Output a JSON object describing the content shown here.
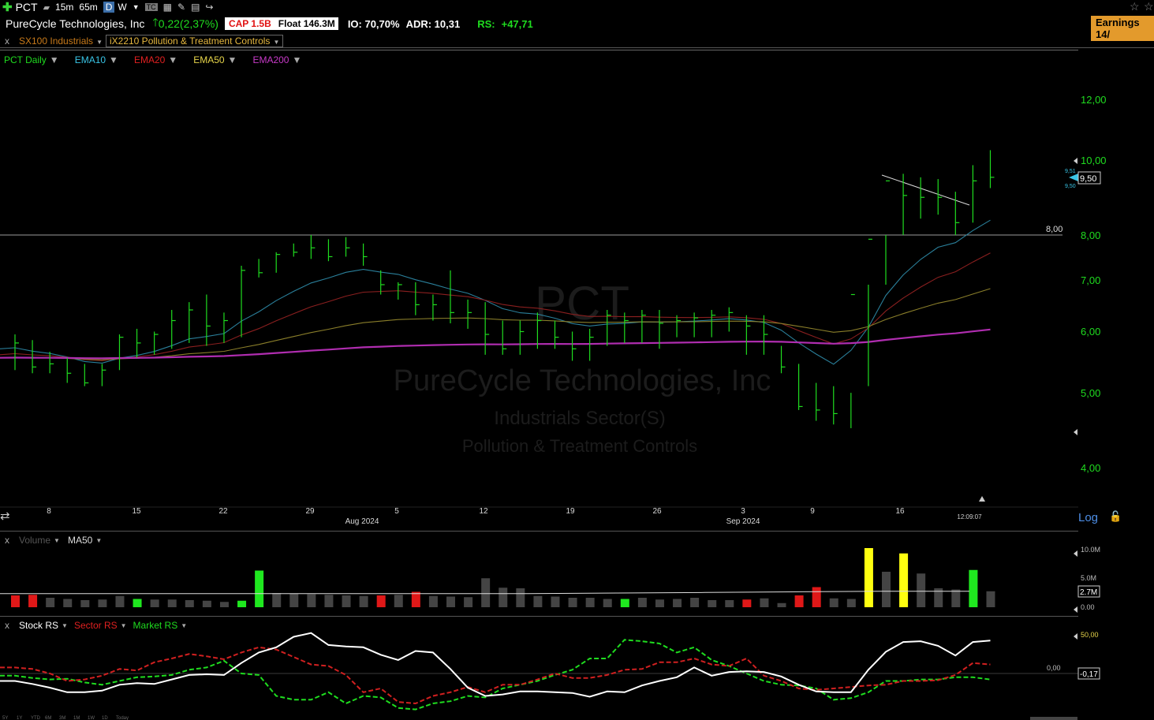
{
  "toolbar": {
    "symbol": "PCT",
    "timeframes": [
      "15m",
      "65m",
      "D",
      "W"
    ],
    "earnings": "Earnings 14/"
  },
  "header": {
    "company": "PureCycle Technologies, Inc",
    "change": "0,22(2,37%)",
    "cap_label": "CAP 1.5B",
    "float_label": "Float 146.3M",
    "io": "IO: 70,70%",
    "adr": "ADR: 10,31",
    "rs_label": "RS:",
    "rs_value": "+47,71"
  },
  "groups": {
    "close": "x",
    "index": "SX100 Industrials",
    "industry": "iX2210 Pollution & Treatment Controls"
  },
  "price_legend": [
    {
      "label": "PCT Daily",
      "color": "#1fdc1f"
    },
    {
      "label": "EMA10",
      "color": "#39c5e6"
    },
    {
      "label": "EMA20",
      "color": "#e02020"
    },
    {
      "label": "EMA50",
      "color": "#e6d44a"
    },
    {
      "label": "EMA200",
      "color": "#c83ac8"
    }
  ],
  "watermark": {
    "symbol": "PCT",
    "name": "PureCycle Technologies, Inc",
    "sector": "Industrials Sector(S)",
    "industry": "Pollution & Treatment Controls"
  },
  "price_axis": {
    "ticks": [
      "12,00",
      "10,00",
      "8,00",
      "7,00",
      "6,00",
      "5,00",
      "4,00"
    ],
    "last_price": "9,50",
    "bid": "9,51",
    "ask": "9,50",
    "hline_label": "8,00",
    "log_label": "Log"
  },
  "date_axis": {
    "days": [
      "8",
      "15",
      "22",
      "29",
      "5",
      "12",
      "19",
      "26",
      "3",
      "9",
      "16"
    ],
    "months": [
      "Aug 2024",
      "Sep 2024"
    ],
    "time": "12:09:07"
  },
  "volume_legend": {
    "close": "x",
    "volume": "Volume",
    "ma": "MA50"
  },
  "volume_axis": {
    "ticks": [
      "10.0M",
      "5.0M",
      "0.00"
    ],
    "ma_value": "2.7M"
  },
  "rs_legend": [
    {
      "label": "Stock RS",
      "color": "#ffffff"
    },
    {
      "label": "Sector RS",
      "color": "#e02020"
    },
    {
      "label": "Market RS",
      "color": "#1fdc1f"
    }
  ],
  "rs_axis": {
    "ticks": [
      "50,00",
      "0,00"
    ],
    "value": "-0,17"
  },
  "ranges": [
    "5Y",
    "1Y",
    "YTD",
    "6M",
    "3M",
    "1M",
    "1W",
    "1D",
    "Today"
  ],
  "chart_data": [
    {
      "type": "ohlc",
      "series": [
        {
          "name": "PCT Daily",
          "dates": [
            "Jul 2",
            "Jul 3",
            "Jul 5",
            "Jul 8",
            "Jul 9",
            "Jul 10",
            "Jul 11",
            "Jul 12",
            "Jul 15",
            "Jul 16",
            "Jul 17",
            "Jul 18",
            "Jul 19",
            "Jul 22",
            "Jul 23",
            "Jul 24",
            "Jul 25",
            "Jul 26",
            "Jul 29",
            "Jul 30",
            "Jul 31",
            "Aug 1",
            "Aug 2",
            "Aug 5",
            "Aug 6",
            "Aug 7",
            "Aug 8",
            "Aug 9",
            "Aug 12",
            "Aug 13",
            "Aug 14",
            "Aug 15",
            "Aug 16",
            "Aug 19",
            "Aug 20",
            "Aug 21",
            "Aug 22",
            "Aug 23",
            "Aug 26",
            "Aug 27",
            "Aug 28",
            "Aug 29",
            "Aug 30",
            "Sep 3",
            "Sep 4",
            "Sep 5",
            "Sep 6",
            "Sep 9",
            "Sep 10",
            "Sep 11",
            "Sep 12",
            "Sep 13",
            "Sep 16",
            "Sep 17",
            "Sep 18",
            "Sep 19",
            "Sep 20"
          ],
          "high": [
            5.95,
            5.85,
            5.65,
            5.55,
            5.45,
            5.45,
            5.95,
            6.05,
            6.0,
            6.4,
            6.55,
            6.7,
            6.35,
            7.3,
            7.45,
            7.6,
            7.8,
            8.0,
            7.9,
            7.95,
            7.8,
            7.2,
            6.95,
            6.95,
            6.7,
            7.2,
            6.6,
            6.55,
            6.2,
            6.2,
            6.35,
            6.2,
            6.0,
            6.05,
            6.4,
            6.35,
            6.4,
            6.4,
            6.3,
            6.35,
            6.4,
            6.45,
            6.3,
            6.3,
            5.75,
            5.45,
            5.15,
            5.1,
            5.0,
            6.9,
            8.0,
            9.6,
            9.5,
            9.45,
            9.1,
            9.85,
            10.3
          ],
          "low": [
            5.35,
            5.3,
            5.3,
            5.15,
            5.1,
            5.1,
            5.35,
            5.55,
            5.6,
            5.7,
            5.8,
            5.75,
            5.8,
            5.9,
            7.05,
            7.15,
            7.5,
            7.45,
            7.4,
            7.5,
            7.3,
            6.7,
            6.6,
            6.3,
            6.2,
            6.15,
            6.05,
            5.6,
            5.6,
            5.6,
            5.7,
            5.7,
            5.5,
            5.5,
            5.75,
            5.8,
            5.8,
            5.7,
            5.9,
            5.9,
            5.9,
            6.0,
            5.6,
            5.6,
            5.3,
            4.75,
            4.6,
            4.55,
            4.5,
            5.1,
            6.9,
            8.0,
            8.4,
            8.5,
            8.0,
            8.3,
            9.2
          ],
          "close": [
            5.8,
            5.4,
            5.45,
            5.3,
            5.15,
            5.35,
            5.9,
            5.8,
            5.95,
            6.2,
            6.4,
            6.1,
            6.2,
            7.2,
            7.15,
            7.55,
            7.6,
            7.7,
            7.5,
            7.7,
            7.5,
            6.9,
            6.9,
            6.5,
            6.5,
            6.35,
            6.35,
            5.95,
            5.7,
            6.0,
            6.2,
            5.9,
            5.7,
            5.9,
            6.3,
            6.2,
            6.3,
            6.15,
            6.2,
            6.25,
            6.3,
            6.35,
            6.1,
            5.95,
            5.4,
            4.8,
            4.75,
            4.7,
            6.7,
            7.9,
            9.4,
            9.0,
            8.95,
            8.95,
            8.3,
            9.4,
            9.5
          ]
        }
      ]
    },
    {
      "type": "bar",
      "title": "Volume",
      "series": [
        {
          "name": "Volume",
          "values": [
            2.0,
            2.1,
            1.6,
            1.4,
            1.2,
            1.3,
            1.9,
            1.4,
            1.3,
            1.3,
            1.2,
            1.1,
            0.9,
            1.1,
            6.2,
            2.4,
            2.3,
            2.2,
            2.1,
            2.0,
            1.9,
            2.0,
            2.1,
            2.6,
            1.9,
            1.8,
            1.7,
            4.9,
            3.3,
            3.2,
            1.9,
            1.8,
            1.6,
            1.6,
            1.4,
            1.4,
            1.6,
            1.3,
            1.4,
            1.6,
            1.2,
            1.2,
            1.3,
            1.5,
            0.7,
            2.0,
            3.4,
            1.5,
            1.4,
            10.0,
            6.0,
            9.1,
            5.7,
            3.2,
            3.0,
            6.3,
            2.7
          ],
          "colors": [
            "red",
            "red",
            "gray",
            "gray",
            "gray",
            "gray",
            "gray",
            "green",
            "gray",
            "gray",
            "gray",
            "gray",
            "gray",
            "green",
            "green",
            "gray",
            "gray",
            "gray",
            "gray",
            "gray",
            "gray",
            "red",
            "gray",
            "red",
            "gray",
            "gray",
            "gray",
            "gray",
            "gray",
            "gray",
            "gray",
            "gray",
            "gray",
            "gray",
            "gray",
            "green",
            "gray",
            "gray",
            "gray",
            "gray",
            "gray",
            "gray",
            "red",
            "gray",
            "gray",
            "red",
            "red",
            "gray",
            "gray",
            "yellow",
            "gray",
            "yellow",
            "gray",
            "gray",
            "gray",
            "green",
            "gray"
          ]
        },
        {
          "name": "MA50",
          "values": [
            2.3,
            2.3,
            2.3,
            2.3,
            2.3,
            2.3,
            2.3,
            2.4,
            2.5,
            2.6,
            2.7,
            2.7
          ]
        }
      ]
    },
    {
      "type": "line",
      "ylim": [
        -40,
        60
      ],
      "series": [
        {
          "name": "Stock RS",
          "values": [
            -10,
            -14,
            -19,
            -25,
            -25,
            -23,
            -15,
            -13,
            -14,
            -8,
            -2,
            -1,
            -2,
            14,
            28,
            35,
            49,
            54,
            38,
            36,
            35,
            25,
            18,
            30,
            28,
            6,
            -19,
            -30,
            -28,
            -24,
            -24,
            -25,
            -26,
            -31,
            -24,
            -25,
            -16,
            -10,
            -5,
            8,
            -3,
            2,
            3,
            2,
            -4,
            -15,
            -24,
            -25,
            -25,
            5,
            29,
            42,
            43,
            37,
            24,
            42,
            44
          ]
        },
        {
          "name": "Sector RS",
          "values": [
            8,
            6,
            0,
            -10,
            -8,
            -3,
            6,
            4,
            15,
            20,
            26,
            23,
            19,
            28,
            35,
            32,
            22,
            12,
            10,
            -2,
            -25,
            -20,
            -38,
            -40,
            -30,
            -25,
            -18,
            -25,
            -15,
            -15,
            -8,
            0,
            -6,
            -6,
            -2,
            5,
            6,
            15,
            15,
            20,
            12,
            10,
            20,
            -3,
            -10,
            -20,
            -22,
            -20,
            -18,
            -16,
            -15,
            -10,
            -10,
            -9,
            -2,
            14,
            12
          ]
        },
        {
          "name": "Market RS",
          "values": [
            -3,
            -6,
            -8,
            -7,
            -12,
            -15,
            -10,
            -5,
            -4,
            -2,
            5,
            8,
            17,
            0,
            -2,
            -30,
            -35,
            -35,
            -25,
            -40,
            -30,
            -32,
            -46,
            -48,
            -40,
            -37,
            -30,
            -32,
            -20,
            -15,
            -10,
            -2,
            5,
            20,
            20,
            45,
            43,
            40,
            28,
            35,
            18,
            10,
            0,
            -10,
            -15,
            -16,
            -20,
            -35,
            -33,
            -25,
            -10,
            -10,
            -8,
            -8,
            -5,
            -5,
            -8
          ]
        }
      ]
    }
  ]
}
